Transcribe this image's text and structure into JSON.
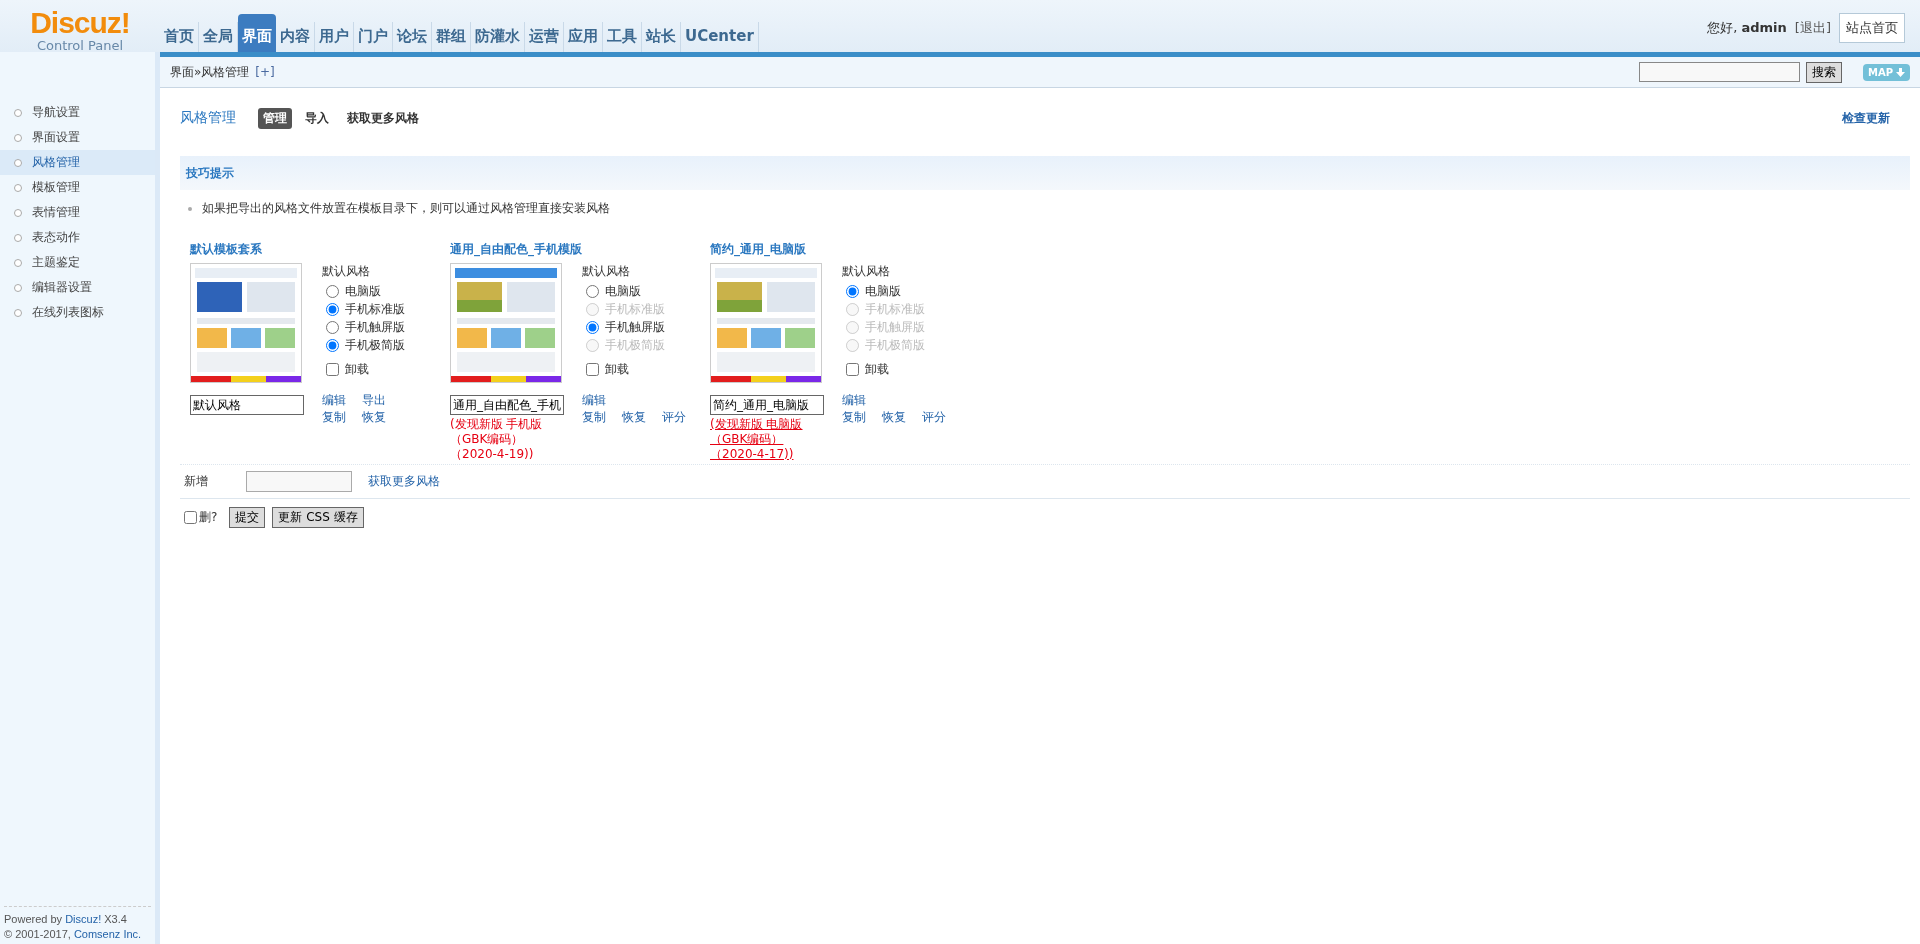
{
  "logo": {
    "name": "Discuz!",
    "subtitle": "Control Panel"
  },
  "nav": [
    {
      "label": "首页",
      "selected": false
    },
    {
      "label": "全局",
      "selected": false
    },
    {
      "label": "界面",
      "selected": true
    },
    {
      "label": "内容",
      "selected": false
    },
    {
      "label": "用户",
      "selected": false
    },
    {
      "label": "门户",
      "selected": false
    },
    {
      "label": "论坛",
      "selected": false
    },
    {
      "label": "群组",
      "selected": false
    },
    {
      "label": "防灌水",
      "selected": false
    },
    {
      "label": "运营",
      "selected": false
    },
    {
      "label": "应用",
      "selected": false
    },
    {
      "label": "工具",
      "selected": false
    },
    {
      "label": "站长",
      "selected": false
    },
    {
      "label": "UCenter",
      "selected": false
    }
  ],
  "user": {
    "greeting": "您好,",
    "name": "admin",
    "logout": "[退出]",
    "site_home": "站点首页"
  },
  "breadcrumb": {
    "items": [
      "界面",
      "风格管理"
    ],
    "separator": "»",
    "add": "[+]"
  },
  "search": {
    "button": "搜索"
  },
  "map_button": "MAP",
  "sidebar": [
    {
      "label": "导航设置",
      "selected": false
    },
    {
      "label": "界面设置",
      "selected": false
    },
    {
      "label": "风格管理",
      "selected": true
    },
    {
      "label": "模板管理",
      "selected": false
    },
    {
      "label": "表情管理",
      "selected": false
    },
    {
      "label": "表态动作",
      "selected": false
    },
    {
      "label": "主题鉴定",
      "selected": false
    },
    {
      "label": "编辑器设置",
      "selected": false
    },
    {
      "label": "在线列表图标",
      "selected": false
    }
  ],
  "footer": {
    "powered": "Powered by",
    "brand": "Discuz!",
    "version": "X3.4",
    "copyright": "© 2001-2017,",
    "company": "Comsenz Inc."
  },
  "page": {
    "title": "风格管理",
    "tabs": [
      {
        "label": "管理",
        "selected": true
      },
      {
        "label": "导入",
        "selected": false
      },
      {
        "label": "获取更多风格",
        "selected": false
      }
    ],
    "check_update": "检查更新"
  },
  "tips": {
    "title": "技巧提示",
    "items": [
      "如果把导出的风格文件放置在模板目录下，则可以通过风格管理直接安装风格"
    ]
  },
  "styles": [
    {
      "name": "默认模板套系",
      "group_label": "默认风格",
      "options": [
        {
          "label": "电脑版",
          "selected": false,
          "disabled": false
        },
        {
          "label": "手机标准版",
          "selected": true,
          "disabled": false
        },
        {
          "label": "手机触屏版",
          "selected": false,
          "disabled": false
        },
        {
          "label": "手机极简版",
          "selected": true,
          "disabled": false
        }
      ],
      "uninstall": {
        "label": "卸载",
        "checked": false
      },
      "name_value": "默认风格",
      "actions": [
        [
          "编辑",
          "导出"
        ],
        [
          "复制",
          "恢复"
        ]
      ]
    },
    {
      "name": "通用_自由配色_手机模版",
      "group_label": "默认风格",
      "options": [
        {
          "label": "电脑版",
          "selected": false,
          "disabled": false
        },
        {
          "label": "手机标准版",
          "selected": false,
          "disabled": true
        },
        {
          "label": "手机触屏版",
          "selected": true,
          "disabled": false
        },
        {
          "label": "手机极简版",
          "selected": false,
          "disabled": true
        }
      ],
      "uninstall": {
        "label": "卸载",
        "checked": false
      },
      "name_value": "通用_自由配色_手机",
      "actions": [
        [
          "编辑"
        ],
        [
          "复制",
          "恢复",
          "评分"
        ]
      ],
      "notice": {
        "text": "(发现新版 手机版（GBK编码）（2020-4-19))",
        "underlined": false
      }
    },
    {
      "name": "简约_通用_电脑版",
      "group_label": "默认风格",
      "options": [
        {
          "label": "电脑版",
          "selected": true,
          "disabled": false
        },
        {
          "label": "手机标准版",
          "selected": false,
          "disabled": true
        },
        {
          "label": "手机触屏版",
          "selected": false,
          "disabled": true
        },
        {
          "label": "手机极简版",
          "selected": false,
          "disabled": true
        }
      ],
      "uninstall": {
        "label": "卸载",
        "checked": false
      },
      "name_value": "简约_通用_电脑版",
      "actions": [
        [
          "编辑"
        ],
        [
          "复制",
          "恢复",
          "评分"
        ]
      ],
      "notice": {
        "text": "(发现新版 电脑版（GBK编码）（2020-4-17))",
        "underlined": true
      }
    }
  ],
  "add_row": {
    "label": "新增",
    "link": "获取更多风格"
  },
  "delete": {
    "label": "删?",
    "checked": false
  },
  "buttons": [
    "提交",
    "更新 CSS 缓存"
  ]
}
